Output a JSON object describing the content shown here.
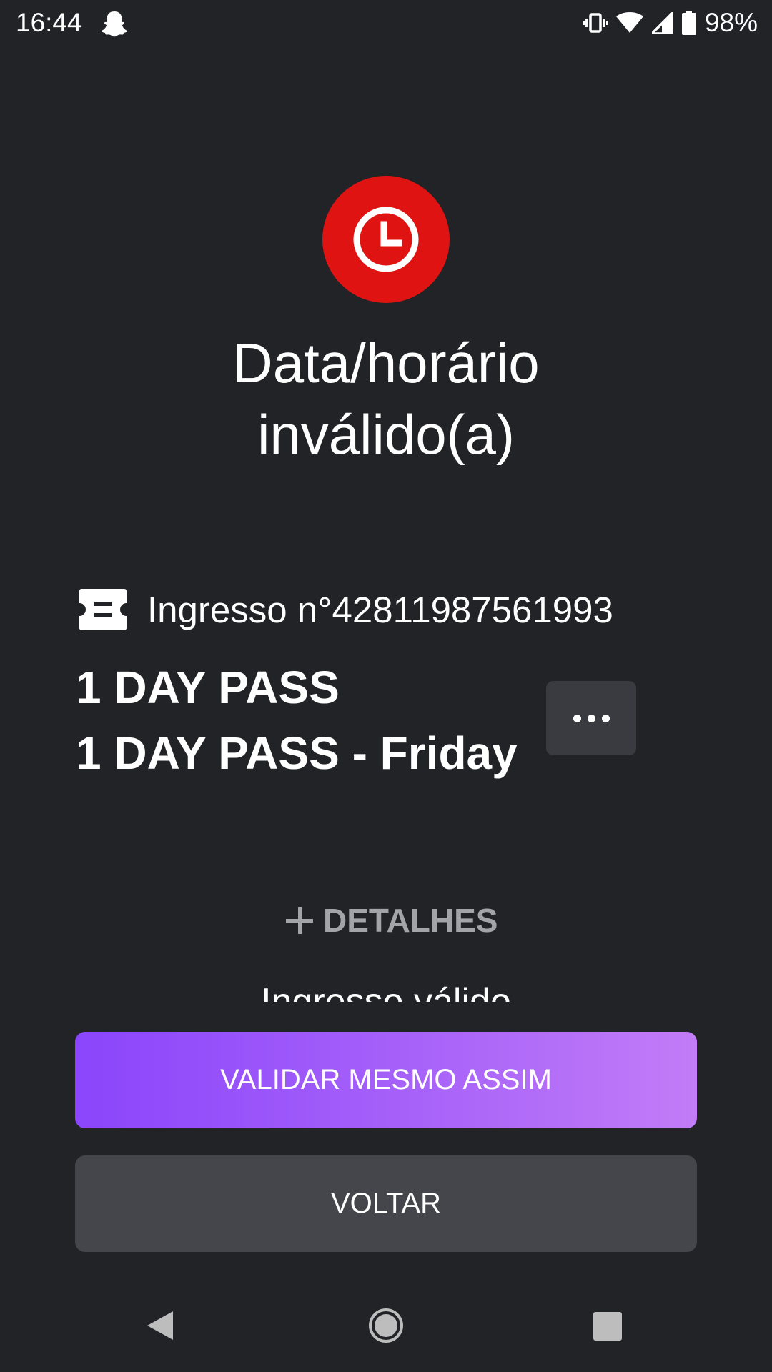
{
  "status_bar": {
    "time": "16:44",
    "notification_icon": "snapchat-ghost-icon",
    "icons": [
      "vibrate-icon",
      "wifi-icon",
      "signal-icon",
      "battery-icon"
    ],
    "battery": "98%"
  },
  "alert": {
    "icon": "clock-icon",
    "icon_color": "#e01313",
    "title_line1": "Data/horário",
    "title_line2": "inválido(a)"
  },
  "ticket": {
    "icon": "ticket-icon",
    "number_label": "Ingresso n°42811987561993",
    "name": "1 DAY PASS",
    "subname": "1 DAY PASS - Friday",
    "more_icon": "more-horizontal-icon"
  },
  "details": {
    "toggle_icon": "plus-icon",
    "toggle_label": "DETALHES",
    "partial_status": "Ingresso válido"
  },
  "actions": {
    "validate_label": "VALIDAR MESMO ASSIM",
    "back_label": "VOLTAR",
    "validate_gradient": [
      "#8b45fb",
      "#c27cf7"
    ],
    "back_color": "#45464b"
  },
  "navigation": {
    "back_icon": "nav-back-icon",
    "home_icon": "nav-home-icon",
    "recent_icon": "nav-recents-icon"
  }
}
